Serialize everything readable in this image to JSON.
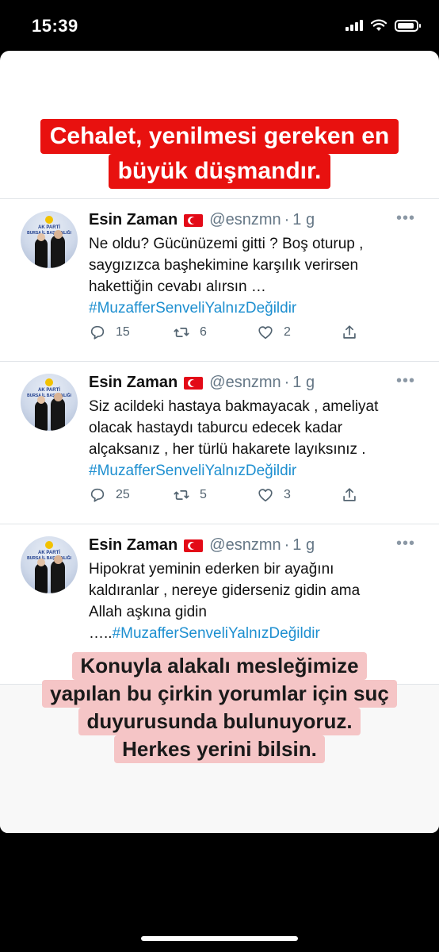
{
  "status_bar": {
    "time": "15:39"
  },
  "top_caption": {
    "line1": "Cehalet, yenilmesi gereken en",
    "line2": "büyük düşmandır."
  },
  "tweets": [
    {
      "name": "Esin Zaman",
      "handle": "@esnzmn",
      "sep": "·",
      "age": "1 g",
      "lines": [
        "Ne oldu? Gücünüzemi gitti ? Boş oturup  ,",
        " saygızızca  başhekimine karşılık verirsen",
        "hakettiğin cevabı alırsın …"
      ],
      "hashtag": "#MuzafferSenveliYalnızDeğildir",
      "replies": "15",
      "retweets": "6",
      "likes": "2"
    },
    {
      "name": "Esin Zaman",
      "handle": "@esnzmn",
      "sep": "·",
      "age": "1 g",
      "lines": [
        "Siz acildeki hastaya bakmayacak , ameliyat",
        "olacak hastaydı taburcu edecek kadar",
        "alçaksanız , her türlü hakarete  layıksınız ."
      ],
      "hashtag": "#MuzafferSenveliYalnızDeğildir",
      "replies": "25",
      "retweets": "5",
      "likes": "3"
    },
    {
      "name": "Esin Zaman",
      "handle": "@esnzmn",
      "sep": "·",
      "age": "1 g",
      "lines": [
        "Hipokrat yeminin ederken bir ayağını",
        "kaldıranlar , nereye giderseniz gidin ama",
        "Allah aşkına gidin"
      ],
      "prefix": "…..",
      "hashtag": "#MuzafferSenveliYalnızDeğildir"
    }
  ],
  "bottom_caption": {
    "line1": "Konuyla alakalı mesleğimize",
    "line2": "yapılan bu çirkin yorumlar için suç",
    "line3": "duyurusunda bulunuyoruz.",
    "line4": "Herkes yerini bilsin."
  },
  "avatar_text": {
    "top": "AK PARTİ",
    "bottom": "BURSA İL BAŞKANLIĞI"
  },
  "colors": {
    "caption_red": "#e8110f",
    "caption_pink": "#f5c5c6",
    "hashtag": "#1d8fd0"
  },
  "icons": [
    "reply-icon",
    "retweet-icon",
    "like-icon",
    "share-icon",
    "more-icon",
    "turkish-flag-icon"
  ]
}
